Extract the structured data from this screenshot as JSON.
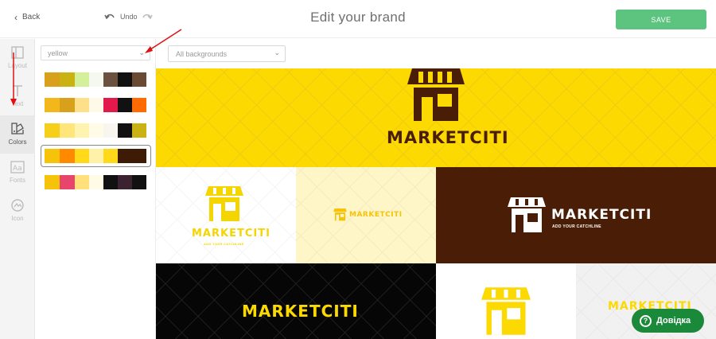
{
  "header": {
    "back_label": "Back",
    "undo_label": "Undo",
    "title": "Edit your brand",
    "save_label": "SAVE"
  },
  "rail": {
    "items": [
      {
        "label": "Layout",
        "icon": "layout-icon"
      },
      {
        "label": "Text",
        "icon": "text-icon"
      },
      {
        "label": "Colors",
        "icon": "colors-icon"
      },
      {
        "label": "Fonts",
        "icon": "fonts-icon"
      },
      {
        "label": "Icon",
        "icon": "icon-icon"
      }
    ],
    "active": "Colors"
  },
  "colors_panel": {
    "selected_color": "yellow",
    "palettes": [
      [
        "#d9a11b",
        "#c9b212",
        "#d4f09a",
        "#f5f8ee",
        "#6b5140",
        "#111111",
        "#6b4a33"
      ],
      [
        "#f3b61b",
        "#d9a11b",
        "#ffe08a",
        "#fff9e8",
        "#e21a4b",
        "#111111",
        "#ff6b00"
      ],
      [
        "#f5cf1a",
        "#ffe57a",
        "#fff3b0",
        "#fffbe6",
        "#f8f6ee",
        "#111111",
        "#c9b212"
      ],
      [
        "#f5c30a",
        "#ff8a00",
        "#ffd91a",
        "#fff2a8",
        "#ffd91a",
        "#3d1b05",
        "#3d1b05"
      ],
      [
        "#f5c30a",
        "#e8456a",
        "#ffe07a",
        "#fffbe6",
        "#111111",
        "#3a2230",
        "#111111"
      ]
    ],
    "selected_palette_index": 3
  },
  "canvas": {
    "background_filter": "All backgrounds",
    "brand_name": "MARKETCITI",
    "tagline": "ADD YOUR CATCHLINE",
    "colors": {
      "yellow": "#fcd900",
      "brown": "#4a1e06",
      "cream": "#fff6c8",
      "black": "#060606",
      "light_gray": "#f1f1f1"
    }
  },
  "help": {
    "label": "Довідка"
  }
}
